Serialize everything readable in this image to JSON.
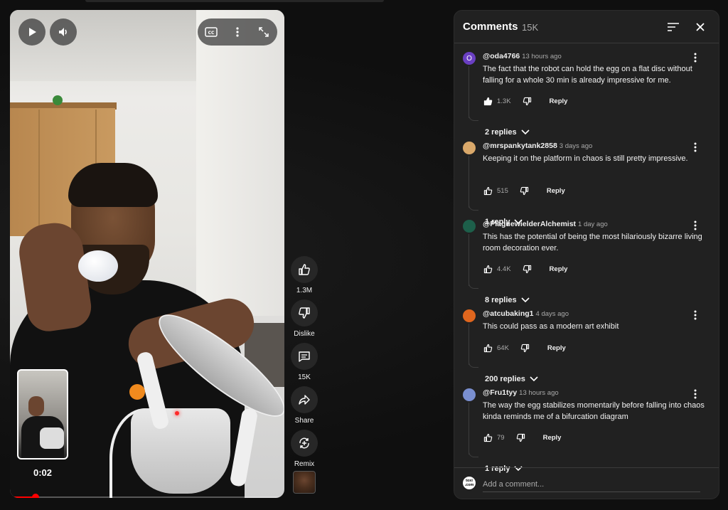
{
  "video": {
    "time": "0:02",
    "progress": 0.08,
    "controls": {
      "play_icon": "play-icon",
      "volume_icon": "volume-icon",
      "cc_icon": "closed-captions-icon",
      "more_icon": "more-vertical-icon",
      "fullscreen_icon": "fullscreen-icon"
    }
  },
  "actions": {
    "like_label": "1.3M",
    "dislike_label": "Dislike",
    "comments_label": "15K",
    "share_label": "Share",
    "remix_label": "Remix"
  },
  "comments_panel": {
    "title": "Comments",
    "count": "15K",
    "add_placeholder": "Add a comment...",
    "add_avatar_text": "toxi .com",
    "reply_label": "Reply",
    "items": [
      {
        "handle": "@oda4766",
        "time": "13 hours ago",
        "text": "The fact that the robot can hold the egg on a flat disc without falling for a whole 30 min is already impressive for me.",
        "likes": "1.3K",
        "replies": "2 replies",
        "avatar_letter": "O",
        "avatar_color": "#6a3fc2",
        "liked": true
      },
      {
        "handle": "@mrspankytank2858",
        "time": "3 days ago",
        "text": "Keeping it on the platform in chaos is still pretty impressive.",
        "likes": "515",
        "replies": "1 reply",
        "avatar_letter": "",
        "avatar_color": "#d9a86a",
        "liked": false
      },
      {
        "handle": "@PlaguewielderAlchemist",
        "time": "1 day ago",
        "text": "This has the potential of being the most hilariously bizarre living room decoration ever.",
        "likes": "4.4K",
        "replies": "8 replies",
        "avatar_letter": "",
        "avatar_color": "#1d5f4a",
        "liked": false
      },
      {
        "handle": "@atcubaking1",
        "time": "4 days ago",
        "text": "This could pass as a modern art exhibit",
        "likes": "64K",
        "replies": "200 replies",
        "avatar_letter": "",
        "avatar_color": "#e0661e",
        "liked": false
      },
      {
        "handle": "@Fru1tyy",
        "time": "13 hours ago",
        "text": "The way the egg stabilizes momentarily before falling into chaos kinda reminds me of a bifurcation diagram",
        "likes": "79",
        "replies": "1 reply",
        "avatar_letter": "",
        "avatar_color": "#7a8fd0",
        "liked": false
      }
    ]
  }
}
